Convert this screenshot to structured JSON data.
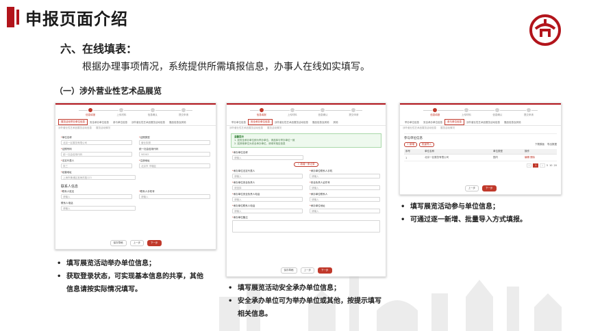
{
  "slide": {
    "title": "申报页面介绍",
    "section_heading": "六、在线填表：",
    "section_desc": "根据办理事项情况，系统提供所需填报信息，办事人在线如实填写。",
    "sub_heading": "（一）涉外营业性艺术品展览"
  },
  "colors": {
    "accent": "#b2141b",
    "primary_button": "#c0392b",
    "notice_bg": "#eef9ee"
  },
  "steps": [
    "信息填报",
    "上传材料",
    "信息确认",
    "提交申请"
  ],
  "panel1": {
    "tabs": [
      "展览活动举办单位信息",
      "安全承办单位信息",
      "参与单位信息",
      "涉外营业性艺术品展览活动信息",
      "展品信息及其他"
    ],
    "tabs2": [
      "涉外营业性艺术品展览活动信息",
      "展览活动情况"
    ],
    "fields": [
      {
        "label": "单位名称",
        "value": "北京一区展览有限公司"
      },
      {
        "label": "证照类型",
        "value": "营业执照"
      },
      {
        "label": "证照号码",
        "value": "统一社会信用代码"
      },
      {
        "label": "统一社会信用代码",
        "value": "98563"
      },
      {
        "label": "法定代表人",
        "value": "张三"
      },
      {
        "label": "注册地址",
        "value": "北京市 市辖区"
      },
      {
        "label": "经营地址",
        "value": "上海市黄浦区淮海东路123"
      }
    ],
    "contact_title": "联系人信息",
    "contact_fields": [
      {
        "label": "联系人姓名",
        "value": "请输入"
      },
      {
        "label": "联系人手机号",
        "value": "请输入"
      },
      {
        "label": "联系人电话",
        "value": "请输入"
      }
    ],
    "buttons": {
      "save": "保存草稿",
      "prev": "上一步",
      "next": "下一步"
    }
  },
  "panel2": {
    "tabs": [
      "举办单位信息",
      "安全承办单位信息",
      "涉外营业性艺术品展览活动信息",
      "展品信息及其他",
      "其他"
    ],
    "tabs2": [
      "涉外营业性艺术品展览活动信息",
      "展览活动情况"
    ],
    "notice_title": "温馨提示",
    "notice_lines": [
      "1. 如安全承办单位即为举办单位，请选择与举办单位一致",
      "2. 如其他单位为安全承办单位，请填写相应信息"
    ],
    "field_top": {
      "label": "承办单位名称",
      "value": "请输入"
    },
    "add_button": "+ 新增一条记录",
    "fields": [
      {
        "label": "承办单位法定代表人",
        "value": "请输入"
      },
      {
        "label": "承办单位联系人手机",
        "value": "请输入"
      },
      {
        "label": "承办单位安全负责人",
        "value": "请选择"
      },
      {
        "label": "安全负责人证件号",
        "value": "请输入"
      },
      {
        "label": "承办单位安全负责人电话",
        "value": "请输入"
      },
      {
        "label": "承办单位联系人",
        "value": "请输入"
      },
      {
        "label": "承办单位联系人电话",
        "value": "请输入"
      },
      {
        "label": "承办单位地址",
        "value": "请输入"
      }
    ],
    "remarks_label": "承办单位备注",
    "buttons": {
      "save": "保存草稿",
      "prev": "上一步",
      "next": "下一步"
    }
  },
  "panel3": {
    "tabs": [
      "举办单位信息",
      "安全承办单位信息",
      "参与单位信息",
      "涉外营业性艺术品展览活动信息",
      "展品信息及其他"
    ],
    "tabs2": [
      "涉外营业性艺术品展览活动信息",
      "展览活动情况"
    ],
    "box_title": "参与单位信息",
    "add_button": "+ 新增",
    "import_button": "批量导入",
    "download_label": "下载模板",
    "export_label": "导出数据",
    "table": {
      "headers": [
        "序号",
        "单位名称",
        "单位类型",
        "操作"
      ],
      "rows": [
        [
          "1",
          "北京一区展览有限公司",
          "国内",
          "编辑 删除"
        ]
      ]
    },
    "pager": [
      "‹",
      "1",
      "›",
      "5",
      "10",
      "20"
    ],
    "buttons": {
      "prev": "上一步",
      "next": "下一步"
    }
  },
  "notes1": [
    {
      "bullet": "•",
      "text": "填写展览活动举办单位信息；"
    },
    {
      "bullet": "•",
      "text": "获取登录状态，可实现基本信息的共享，其他",
      "cont": "信息请按实际情况填写。"
    }
  ],
  "notes2": [
    {
      "bullet": "•",
      "text": "填写展览活动安全承办单位信息；"
    },
    {
      "bullet": "•",
      "text": "安全承办单位可为举办单位或其他，按提示填写",
      "cont": "相关信息。"
    }
  ],
  "notes3": [
    {
      "bullet": "•",
      "text": "填写展览活动参与单位信息；"
    },
    {
      "bullet": "•",
      "text": "可通过逐一新增、批量导入方式填报。"
    }
  ]
}
